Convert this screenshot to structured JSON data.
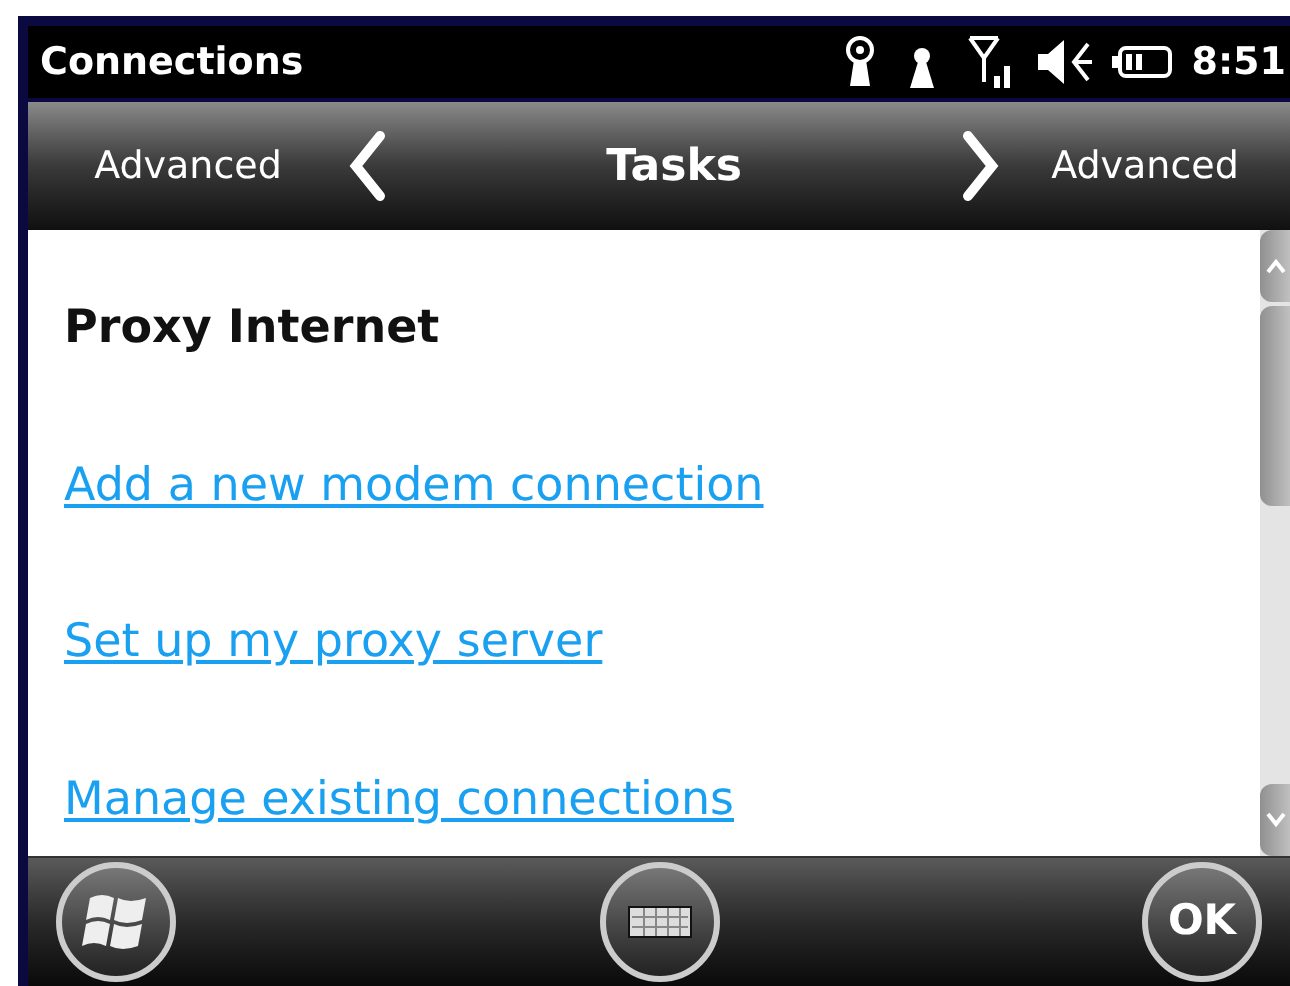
{
  "window": {
    "title": "Connections"
  },
  "status_bar": {
    "time": "8:51"
  },
  "tab_bar": {
    "previous": "Advanced",
    "current": "Tasks",
    "next": "Advanced"
  },
  "content": {
    "heading": "Proxy Internet",
    "links": [
      "Add a new modem connection",
      "Set up my proxy server",
      "Manage existing connections"
    ]
  },
  "softkeys": {
    "ok": "OK"
  }
}
